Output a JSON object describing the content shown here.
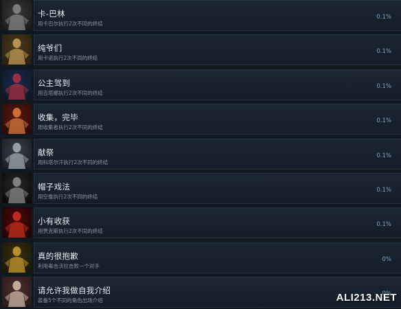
{
  "achievements": [
    {
      "title": "卡-巴林",
      "description": "用卡巴尔执行2次不同的终结",
      "percent": "0.1%",
      "icon": "cyborg-character-icon",
      "theme": [
        "#3a3a3a",
        "#8a8a8a",
        "#1a1a1a"
      ]
    },
    {
      "title": "纯爷们",
      "description": "用卡诺执行2次不同的终结",
      "percent": "0.1%",
      "icon": "muscular-fighter-icon",
      "theme": [
        "#4a3a1a",
        "#c9a35a",
        "#2a2010"
      ]
    },
    {
      "title": "公主驾到",
      "description": "用吉塔娜执行2次不同的终结",
      "percent": "0.1%",
      "icon": "princess-fighter-icon",
      "theme": [
        "#1a2a4a",
        "#b03040",
        "#101828"
      ]
    },
    {
      "title": "收集，完毕",
      "description": "用收集者执行2次不同的终结",
      "percent": "0.1%",
      "icon": "collector-character-icon",
      "theme": [
        "#5a1a10",
        "#e08040",
        "#2a0a08"
      ]
    },
    {
      "title": "献祭",
      "description": "用科塔尔汗执行2次不同的终结",
      "percent": "0.1%",
      "icon": "grey-warrior-icon",
      "theme": [
        "#3a4048",
        "#a8b0b8",
        "#1a1e22"
      ]
    },
    {
      "title": "帽子戏法",
      "description": "用空像执行2次不同的终结",
      "percent": "0.1%",
      "icon": "hat-fighter-icon",
      "theme": [
        "#2a2a2a",
        "#909090",
        "#0a0a0a"
      ]
    },
    {
      "title": "小有收获",
      "description": "用贾克斯执行2次不同的终结",
      "percent": "0.1%",
      "icon": "red-warrior-icon",
      "theme": [
        "#4a0a08",
        "#d03020",
        "#200404"
      ]
    },
    {
      "title": "真的很抱歉",
      "description": "利用毒击沃拉击败一个对手",
      "percent": "0%",
      "icon": "gold-creature-icon",
      "theme": [
        "#3a3010",
        "#d0a030",
        "#1a1808"
      ]
    },
    {
      "title": "请允许我做自我介绍",
      "description": "装备5个不同的角色出场介绍",
      "percent": "0%",
      "icon": "red-robed-fighter-icon",
      "theme": [
        "#4a3030",
        "#d8c0b0",
        "#2a1818"
      ]
    }
  ],
  "watermark": "ALI213.NET"
}
